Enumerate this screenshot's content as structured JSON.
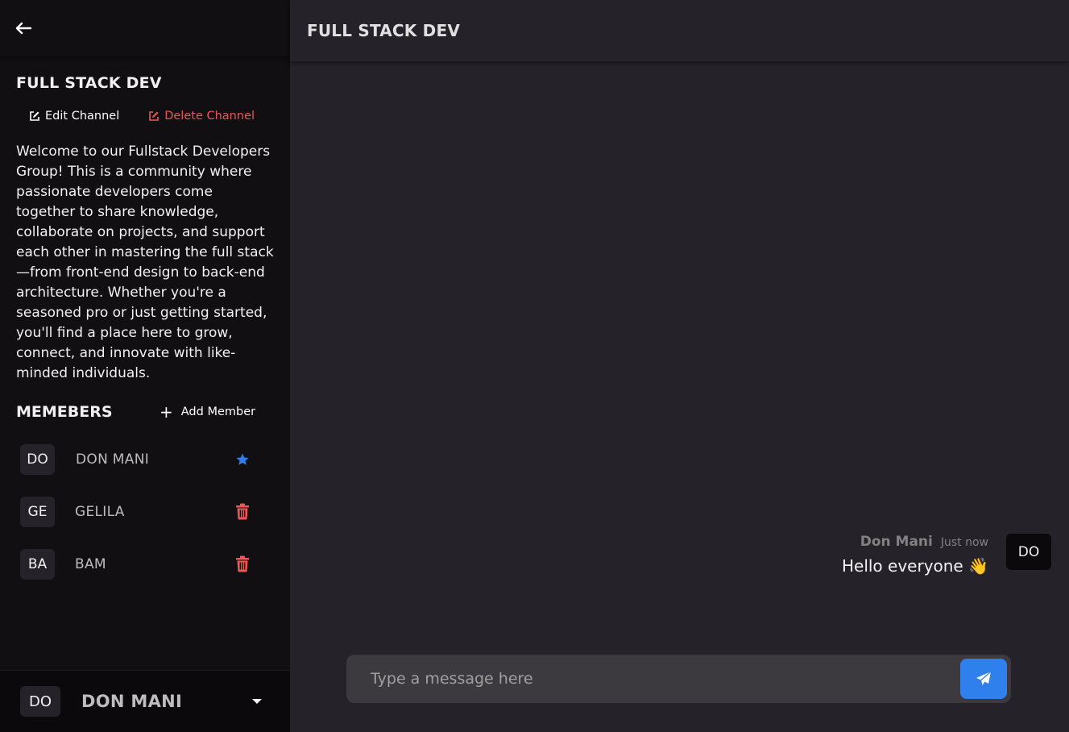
{
  "channel": {
    "title": "FULL STACK DEV",
    "edit_label": "Edit Channel",
    "delete_label": "Delete Channel",
    "description": "Welcome to our Fullstack Developers Group! This is a community where passionate developers come together to share knowledge, collaborate on projects, and support each other in mastering the full stack—from front-end design to back-end architecture. Whether you're a seasoned pro or just getting started, you'll find a place here to grow, connect, and innovate with like-minded individuals."
  },
  "members": {
    "title": "MEMEBERS",
    "add_label": "Add Member",
    "items": [
      {
        "initials": "DO",
        "name": "DON MANI",
        "icon": "star-icon"
      },
      {
        "initials": "GE",
        "name": "GELILA",
        "icon": "trash-icon"
      },
      {
        "initials": "BA",
        "name": "BAM",
        "icon": "trash-icon"
      }
    ]
  },
  "current_user": {
    "initials": "DO",
    "name": "DON MANI"
  },
  "main": {
    "title": "FULL STACK DEV",
    "messages": [
      {
        "author": "Don Mani",
        "time": "Just now",
        "text": "Hello everyone 👋",
        "initials": "DO"
      }
    ]
  },
  "composer": {
    "placeholder": "Type a message here",
    "value": ""
  },
  "colors": {
    "sidebar_bg": "#120f13",
    "main_bg": "#252329",
    "accent": "#2f80ed",
    "danger": "#eb5757",
    "input_bg": "#3c393f"
  }
}
